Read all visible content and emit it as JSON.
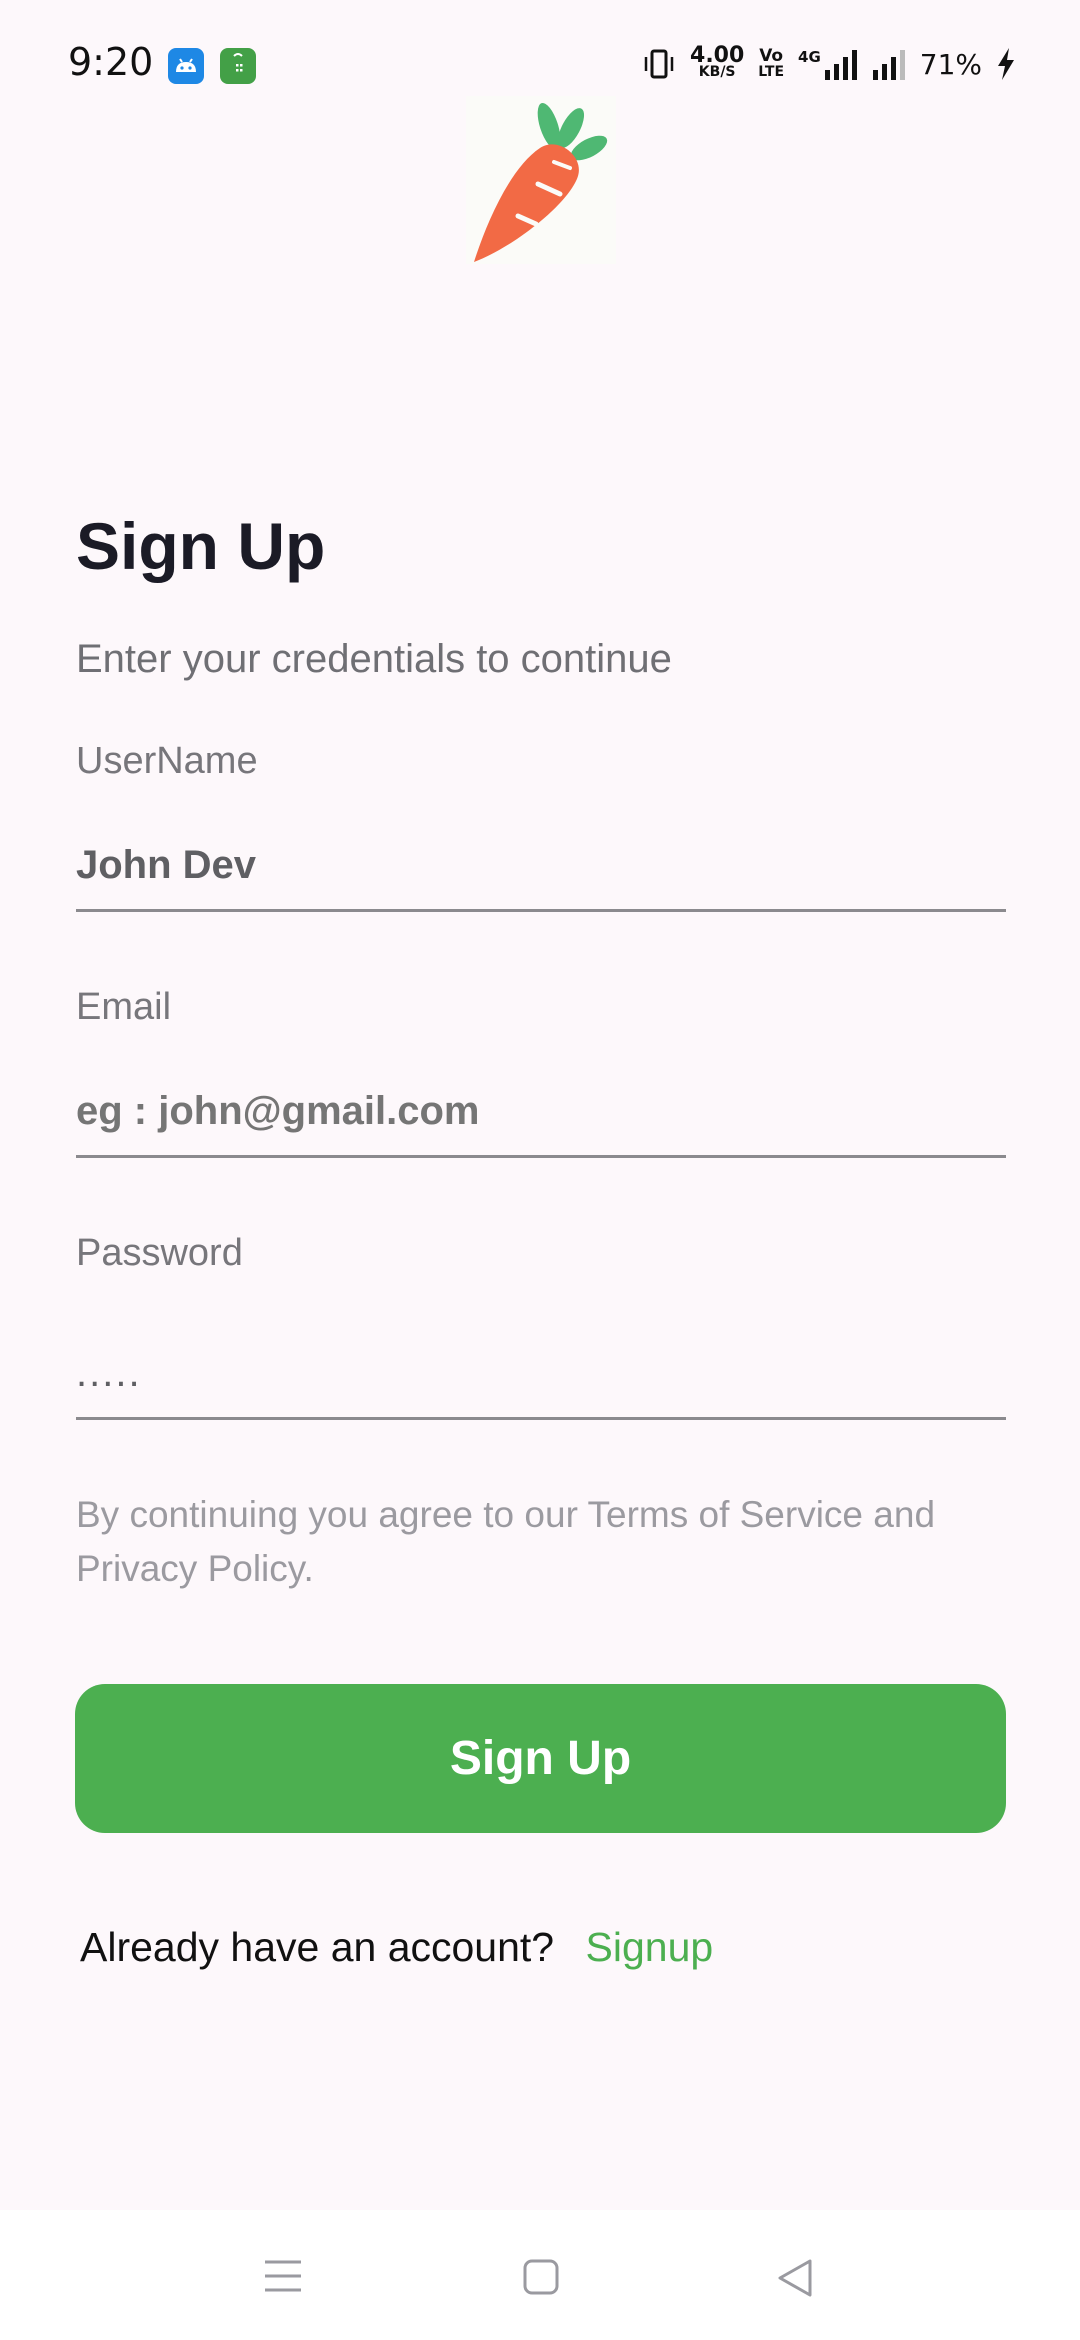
{
  "status_bar": {
    "time": "9:20",
    "network_speed_value": "4.00",
    "network_speed_unit": "KB/S",
    "volte_top": "Vo",
    "volte_bottom": "LTE",
    "network_type": "4G",
    "battery": "71%"
  },
  "header": {
    "logo_icon": "carrot-icon"
  },
  "form": {
    "title": "Sign Up",
    "subtitle": "Enter your credentials to continue",
    "username": {
      "label": "UserName",
      "value": "John Dev"
    },
    "email": {
      "label": "Email",
      "placeholder": "eg : john@gmail.com"
    },
    "password": {
      "label": "Password",
      "value": "....."
    },
    "terms_text": " By continuing you agree to our Terms of Service and Privacy Policy.",
    "submit_label": "Sign Up"
  },
  "footer": {
    "prompt": "Already have an account?",
    "link": "Signup"
  },
  "nav": {
    "icons": [
      "menu-icon",
      "home-icon",
      "back-icon"
    ]
  },
  "colors": {
    "accent": "#4caf50",
    "background": "#fdf8fb",
    "carrot": "#f26a45",
    "leaves": "#4fb873"
  }
}
